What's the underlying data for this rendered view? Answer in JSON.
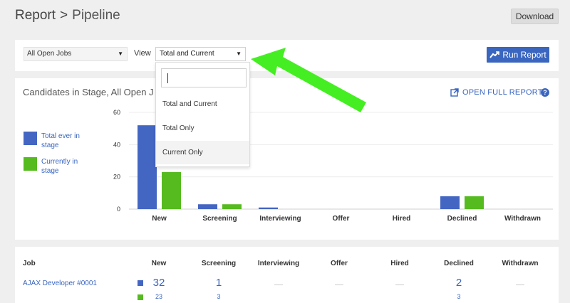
{
  "header": {
    "breadcrumb_root": "Report",
    "breadcrumb_sep": ">",
    "breadcrumb_current": "Pipeline",
    "download_label": "Download"
  },
  "filters": {
    "jobs_value": "All Open Jobs",
    "view_label": "View",
    "view_value": "Total and Current",
    "run_report_label": "Run Report"
  },
  "dropdown": {
    "search_value": "",
    "options": [
      "Total and Current",
      "Total Only",
      "Current Only"
    ],
    "hovered_option": "Current Only"
  },
  "chart_panel": {
    "title": "Candidates in Stage, All Open J",
    "open_full_report_label": "OPEN FULL REPORT",
    "help_label": "?"
  },
  "legend": {
    "total_label": "Total ever in stage",
    "current_label": "Currently in stage"
  },
  "colors": {
    "accent": "#3a66c0",
    "total_series": "#4466c3",
    "current_series": "#55bb1f",
    "arrow": "#44ee22"
  },
  "icons": {
    "jobs_caret": "caret-down-icon",
    "view_caret": "caret-down-icon",
    "run_report": "chart-icon",
    "open_report": "external-link-icon",
    "help": "help-icon"
  },
  "chart_data": {
    "type": "bar",
    "categories": [
      "New",
      "Screening",
      "Interviewing",
      "Offer",
      "Hired",
      "Declined",
      "Withdrawn"
    ],
    "series": [
      {
        "name": "Total ever in stage",
        "values": [
          52,
          3,
          1,
          0,
          0,
          8,
          0
        ]
      },
      {
        "name": "Currently in stage",
        "values": [
          23,
          3,
          0,
          0,
          0,
          8,
          0
        ]
      }
    ],
    "yticks": [
      "0",
      "20",
      "40",
      "60"
    ],
    "ylim": [
      0,
      60
    ],
    "grid": true,
    "legend_position": "left"
  },
  "table": {
    "job_header": "Job",
    "stage_headers": [
      "New",
      "Screening",
      "Interviewing",
      "Offer",
      "Hired",
      "Declined",
      "Withdrawn"
    ],
    "rows": [
      {
        "job": "AJAX Developer #0001",
        "cells": [
          {
            "total": "32",
            "current": "23"
          },
          {
            "total": "1",
            "current": "3"
          },
          null,
          null,
          null,
          {
            "total": "2",
            "current": "3"
          },
          null
        ]
      }
    ]
  }
}
